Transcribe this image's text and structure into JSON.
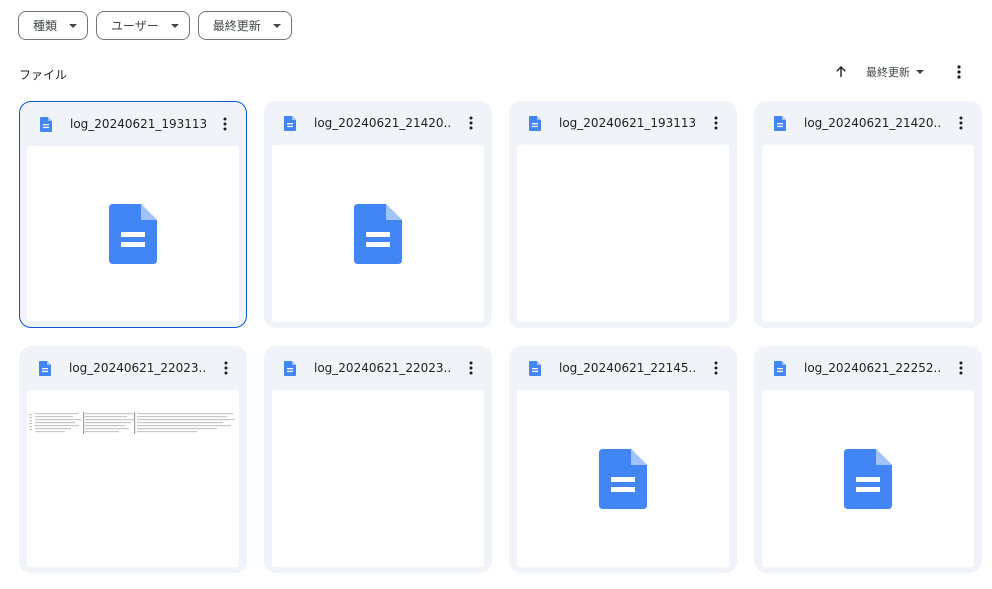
{
  "filters": [
    {
      "label": "種類"
    },
    {
      "label": "ユーザー"
    },
    {
      "label": "最終更新"
    }
  ],
  "section_title": "ファイル",
  "sort": {
    "label": "最終更新"
  },
  "files": [
    {
      "name": "log_20240621_193113...",
      "thumb": "doc-icon",
      "selected": true
    },
    {
      "name": "log_20240621_21420...",
      "thumb": "doc-icon",
      "selected": false
    },
    {
      "name": "log_20240621_193113...",
      "thumb": "blank",
      "selected": false
    },
    {
      "name": "log_20240621_21420...",
      "thumb": "blank",
      "selected": false
    },
    {
      "name": "log_20240621_22023...",
      "thumb": "text-preview",
      "selected": false
    },
    {
      "name": "log_20240621_22023...",
      "thumb": "blank",
      "selected": false
    },
    {
      "name": "log_20240621_22145...",
      "thumb": "doc-icon",
      "selected": false
    },
    {
      "name": "log_20240621_22252...",
      "thumb": "doc-icon",
      "selected": false
    }
  ],
  "colors": {
    "doc_blue": "#4285f4",
    "selected_border": "#0b57d0",
    "card_bg": "#f0f4f9"
  }
}
